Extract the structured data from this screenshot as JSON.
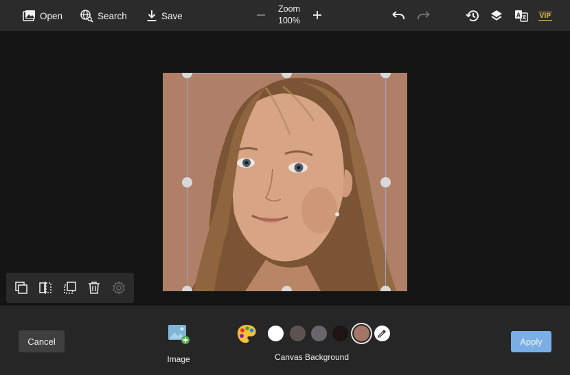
{
  "toolbar": {
    "open_label": "Open",
    "search_label": "Search",
    "save_label": "Save",
    "zoom_label": "Zoom",
    "zoom_value": "100%",
    "vip_label": "VIP",
    "icons": {
      "open": "image-icon",
      "search": "globe-search-icon",
      "save": "download-icon",
      "zoom_out": "minus-icon",
      "zoom_in": "plus-icon",
      "undo": "undo-icon",
      "redo": "redo-icon",
      "history": "history-icon",
      "layers": "layers-icon",
      "translate": "translate-icon"
    },
    "redo_enabled": false
  },
  "canvas": {
    "background_color": "#b07f68",
    "content": "portrait photo"
  },
  "mini_toolbar": {
    "items": [
      "duplicate-icon",
      "flip-icon",
      "crop-icon",
      "trash-icon",
      "settings-icon"
    ],
    "settings_enabled": false
  },
  "bottom": {
    "cancel_label": "Cancel",
    "apply_label": "Apply",
    "image_label": "Image",
    "canvas_background_label": "Canvas Background",
    "swatches": [
      {
        "color": "#ffffff",
        "selected": false
      },
      {
        "color": "#5e5252",
        "selected": false
      },
      {
        "color": "#68666a",
        "selected": false
      },
      {
        "color": "#1c1513",
        "selected": false
      },
      {
        "color": "#a37665",
        "selected": true
      }
    ],
    "accent_color": "#7baee6"
  }
}
